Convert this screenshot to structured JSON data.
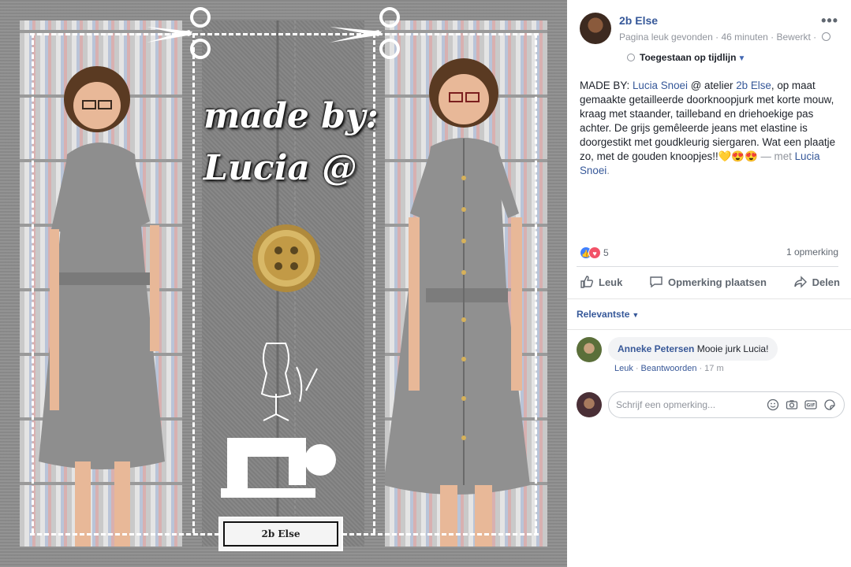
{
  "photo": {
    "caption_line1": "made by:",
    "caption_line2": "Lucia @",
    "logo_text": "2b Else"
  },
  "post": {
    "page_name": "2b Else",
    "activity": "Pagina leuk gevonden",
    "time": "46 minuten",
    "edited": "Bewerkt",
    "privacy_icon": "globe-icon",
    "timeline_label": "Toegestaan op tijdlijn",
    "text_prefix": "MADE BY: ",
    "text_mention1": "Lucia Snoei",
    "text_mid": " @ atelier ",
    "text_mention2": "2b Else",
    "text_body": ", op maat gemaakte getailleerde doorknoopjurk met korte mouw, kraag met staander, tailleband en driehoekige pas achter. De grijs gemêleerde jeans met elastine is doorgestikt met goudkleurig siergaren. Wat een plaatje zo, met de gouden knoopjes!!💛😍😍",
    "text_with": " — met ",
    "text_mention3": "Lucia Snoei",
    "text_end": "."
  },
  "reactions": {
    "count": "5",
    "comment_count": "1 opmerking"
  },
  "actions": {
    "like": "Leuk",
    "comment": "Opmerking plaatsen",
    "share": "Delen"
  },
  "sort_label": "Relevantste",
  "comment": {
    "author": "Anneke Petersen",
    "text": "Mooie jurk Lucia!",
    "like": "Leuk",
    "reply": "Beantwoorden",
    "time": "17 m"
  },
  "write_placeholder": "Schrijf een opmerking...",
  "colors": {
    "link": "#365899",
    "like_blue": "#4080ff",
    "love_red": "#f25268"
  }
}
